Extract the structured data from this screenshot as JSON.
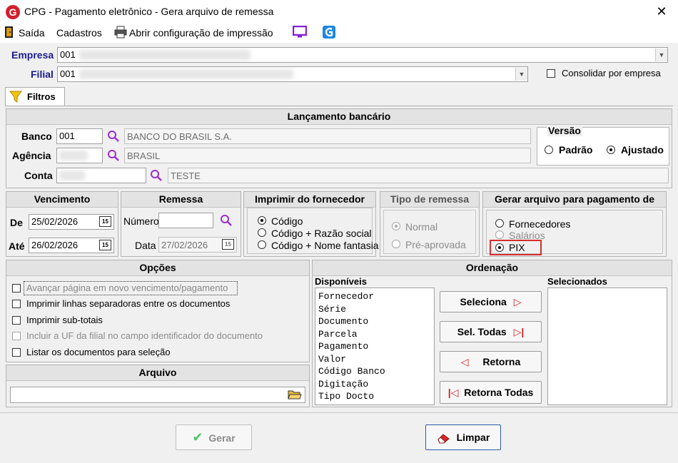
{
  "window": {
    "title": "CPG -  Pagamento eletrônico - Gera arquivo de remessa",
    "logo_letter": "G",
    "close_glyph": "✕"
  },
  "menu": {
    "exit": "Saída",
    "registers": "Cadastros",
    "print_config": "Abrir configuração de impressão"
  },
  "company": {
    "empresa_label": "Empresa",
    "empresa_value": "001",
    "filial_label": "Filial",
    "filial_value": "001",
    "consolidar_label": "Consolidar por empresa"
  },
  "tabs": {
    "filters": "Filtros"
  },
  "bank": {
    "title": "Lançamento bancário",
    "banco_label": "Banco",
    "banco_value": "001",
    "banco_name": "BANCO DO BRASIL S.A.",
    "agencia_label": "Agência",
    "agencia_name": "BRASIL",
    "conta_label": "Conta",
    "conta_name": "TESTE"
  },
  "version": {
    "title": "Versão",
    "standard": "Padrão",
    "adjusted": "Ajustado",
    "selected": "adjusted"
  },
  "due": {
    "title": "Vencimento",
    "from_label": "De",
    "from_value": "25/02/2026",
    "to_label": "Até",
    "to_value": "26/02/2026",
    "cal_glyph": "15"
  },
  "remittance": {
    "title": "Remessa",
    "number_label": "Número",
    "date_label": "Data",
    "date_value": "27/02/2026"
  },
  "print_supplier": {
    "title": "Imprimir do fornecedor",
    "options": [
      "Código",
      "Código + Razão social",
      "Código + Nome fantasia"
    ],
    "selected": 0
  },
  "remittance_type": {
    "title": "Tipo de remessa",
    "options": [
      "Normal",
      "Pré-aprovada"
    ],
    "selected": 0
  },
  "generate_for": {
    "title": "Gerar arquivo para pagamento de",
    "options": [
      "Fornecedores",
      "Salários",
      "PIX"
    ],
    "selected": 2,
    "highlight_color": "#d32f2f"
  },
  "options": {
    "title": "Opções",
    "items": [
      "Avançar página em novo vencimento/pagamento",
      "Imprimir linhas separadoras entre os documentos",
      "Imprimir sub-totais",
      "Incluir a UF da filial no campo identificador do documento",
      "Listar os documentos para seleção"
    ]
  },
  "file": {
    "title": "Arquivo",
    "value": ""
  },
  "ordering": {
    "title": "Ordenação",
    "available_label": "Disponíveis",
    "selected_label": "Selecionados",
    "available": [
      "Fornecedor",
      "Série",
      "Documento",
      "Parcela",
      "Pagamento",
      "Valor",
      "Código Banco",
      "Digitação",
      "Tipo Docto"
    ],
    "select_btn": "Seleciona",
    "select_all_btn": "Sel. Todas",
    "return_btn": "Retorna",
    "return_all_btn": "Retorna Todas"
  },
  "footer": {
    "generate_btn": "Gerar",
    "clear_btn": "Limpar"
  }
}
